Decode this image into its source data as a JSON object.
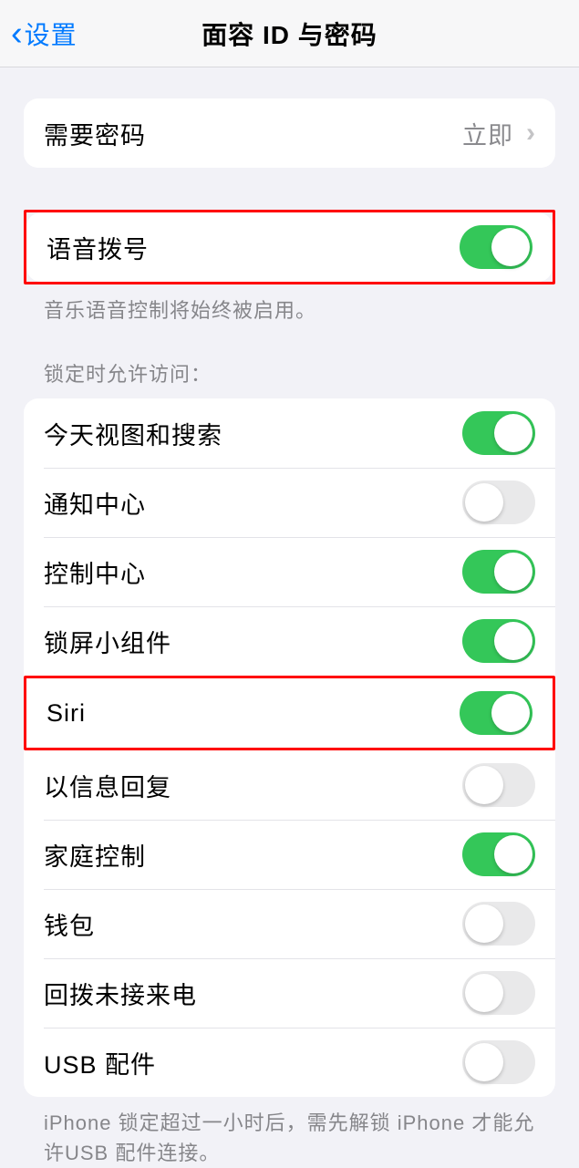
{
  "header": {
    "back_label": "设置",
    "title": "面容 ID 与密码"
  },
  "section1": {
    "require_passcode_label": "需要密码",
    "require_passcode_value": "立即"
  },
  "section2": {
    "voice_dial_label": "语音拨号",
    "voice_dial_on": true,
    "footer": "音乐语音控制将始终被启用。"
  },
  "section3": {
    "header": "锁定时允许访问：",
    "items": [
      {
        "label": "今天视图和搜索",
        "on": true,
        "highlighted": false
      },
      {
        "label": "通知中心",
        "on": false,
        "highlighted": false
      },
      {
        "label": "控制中心",
        "on": true,
        "highlighted": false
      },
      {
        "label": "锁屏小组件",
        "on": true,
        "highlighted": false
      },
      {
        "label": "Siri",
        "on": true,
        "highlighted": true
      },
      {
        "label": "以信息回复",
        "on": false,
        "highlighted": false
      },
      {
        "label": "家庭控制",
        "on": true,
        "highlighted": false
      },
      {
        "label": "钱包",
        "on": false,
        "highlighted": false
      },
      {
        "label": "回拨未接来电",
        "on": false,
        "highlighted": false
      },
      {
        "label": "USB 配件",
        "on": false,
        "highlighted": false
      }
    ],
    "footer": "iPhone 锁定超过一小时后，需先解锁 iPhone 才能允许USB 配件连接。"
  }
}
